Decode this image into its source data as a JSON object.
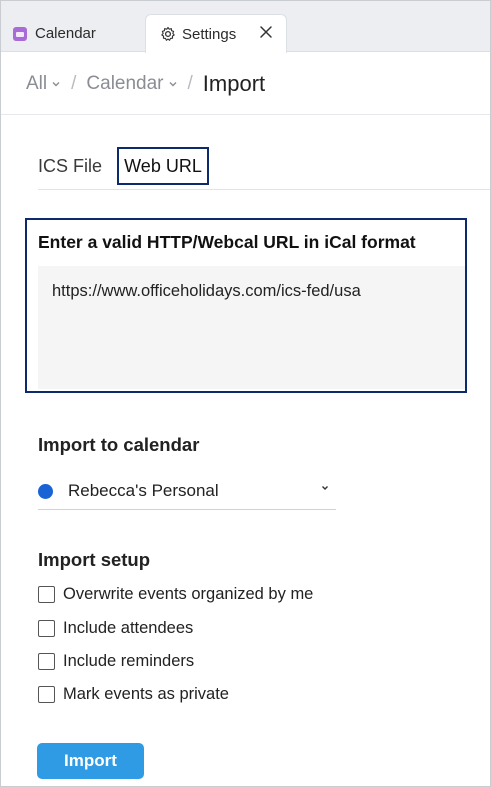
{
  "tabs": [
    {
      "label": "Calendar",
      "icon": "calendar-app-icon",
      "active": false
    },
    {
      "label": "Settings",
      "icon": "gear-icon",
      "active": true
    }
  ],
  "breadcrumb": {
    "items": [
      {
        "label": "All",
        "has_dropdown": true
      },
      {
        "label": "Calendar",
        "has_dropdown": true
      }
    ],
    "separator": "/",
    "current": "Import"
  },
  "import_tabs": [
    {
      "label": "ICS File",
      "active": false
    },
    {
      "label": "Web URL",
      "active": true
    }
  ],
  "url_section": {
    "label": "Enter a valid HTTP/Webcal URL in iCal format",
    "value": "https://www.officeholidays.com/ics-fed/usa"
  },
  "calendar_section": {
    "title": "Import to calendar",
    "selected": "Rebecca's Personal",
    "selected_color": "#1a63d6"
  },
  "setup_section": {
    "title": "Import setup",
    "options": [
      {
        "label": "Overwrite events organized by me",
        "checked": false
      },
      {
        "label": "Include attendees",
        "checked": false
      },
      {
        "label": "Include reminders",
        "checked": false
      },
      {
        "label": "Mark events as private",
        "checked": false
      }
    ]
  },
  "import_button": {
    "label": "Import"
  },
  "colors": {
    "accent": "#2f9be4",
    "highlight_border": "#0d2a6e",
    "calendar_app_icon": "#a86bd8"
  }
}
